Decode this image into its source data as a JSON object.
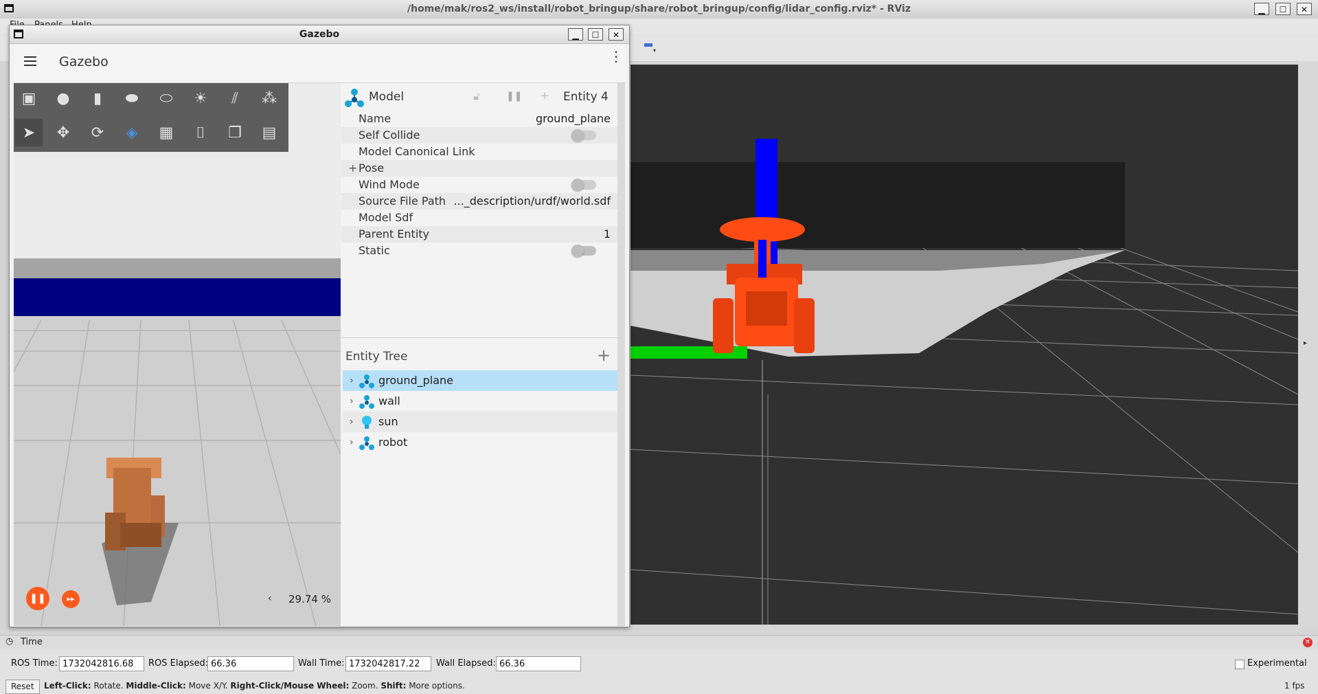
{
  "rviz": {
    "title": "/home/mak/ros2_ws/install/robot_bringup/share/robot_bringup/config/lidar_config.rviz* - RViz",
    "menu": [
      "File",
      "Panels",
      "Help"
    ],
    "time_panel": {
      "title": "Time",
      "ros_time_label": "ROS Time:",
      "ros_time": "1732042816.68",
      "ros_elapsed_label": "ROS Elapsed:",
      "ros_elapsed": "66.36",
      "wall_time_label": "Wall Time:",
      "wall_time": "1732042817.22",
      "wall_elapsed_label": "Wall Elapsed:",
      "wall_elapsed": "66.36",
      "experimental_label": "Experimental"
    },
    "status": {
      "reset_label": "Reset",
      "hint_1_key": "Left-Click:",
      "hint_1_text": " Rotate. ",
      "hint_2_key": "Middle-Click:",
      "hint_2_text": " Move X/Y. ",
      "hint_3_key": "Right-Click/Mouse Wheel:",
      "hint_3_text": " Zoom. ",
      "hint_4_key": "Shift:",
      "hint_4_text": " More options.",
      "fps": "1 fps"
    }
  },
  "gazebo": {
    "window_title": "Gazebo",
    "app_title": "Gazebo",
    "realtime_factor": "29.74 %",
    "component_inspector": {
      "type": "Model",
      "entity": "Entity 4",
      "rows": [
        {
          "label": "Name",
          "value": "ground_plane"
        },
        {
          "label": "Self Collide",
          "value": ""
        },
        {
          "label": "Model Canonical Link",
          "value": ""
        },
        {
          "label": "Pose",
          "value": ""
        },
        {
          "label": "Wind Mode",
          "value": ""
        },
        {
          "label": "Source File Path",
          "value": "..._description/urdf/world.sdf"
        },
        {
          "label": "Model Sdf",
          "value": ""
        },
        {
          "label": "Parent Entity",
          "value": "1"
        },
        {
          "label": "Static",
          "value": ""
        }
      ]
    },
    "entity_tree": {
      "title": "Entity Tree",
      "items": [
        {
          "name": "ground_plane"
        },
        {
          "name": "wall"
        },
        {
          "name": "sun"
        },
        {
          "name": "robot"
        }
      ]
    }
  },
  "colors": {
    "accent_orange": "#ff5a1e",
    "selection_blue": "#b6e0f7",
    "model_icon": "#1aa3d6"
  }
}
